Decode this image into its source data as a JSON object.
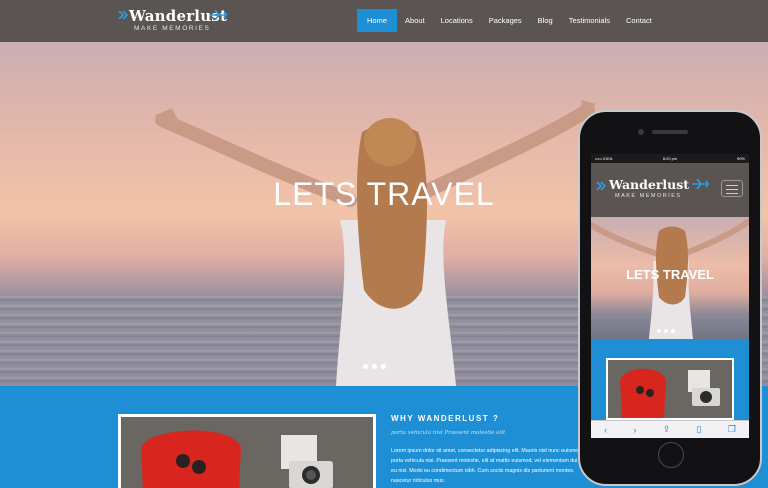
{
  "brand": {
    "name": "Wanderlust",
    "tagline": "MAKE MEMORIES",
    "accent_color": "#1e8fd5",
    "header_color": "#5a5553"
  },
  "nav": {
    "items": [
      {
        "label": "Home",
        "active": true
      },
      {
        "label": "About"
      },
      {
        "label": "Locations"
      },
      {
        "label": "Packages"
      },
      {
        "label": "Blog"
      },
      {
        "label": "Testimonials"
      },
      {
        "label": "Contact"
      }
    ]
  },
  "hero": {
    "title": "LETS TRAVEL",
    "slides": 3,
    "active_slide": 1
  },
  "about": {
    "title": "WHY WANDERLUST ?",
    "subtitle": "porta vehicula nisi Praesent molestie elit",
    "body": "Lorem ipsum dolor sit amet, consectetur adipiscing elit. Mauris nisl nunc euismod, porta vehicula nisi. Praesent molestie, elit at mattis euismod, vel elementum dui sem eu nisi. Morbi eu condimentum nibh. Cum sociis magnis dis parturient montes, nascetur ridiculus mus."
  },
  "phone": {
    "status": {
      "carrier": "••••• IDEA",
      "time": "8:20 pm",
      "battery": "90%"
    },
    "brand_name": "Wanderlust",
    "tagline": "MAKE MEMORIES",
    "hero_title": "LETS TRAVEL",
    "toolbar_icons": [
      "back-icon",
      "forward-icon",
      "share-icon",
      "bookmarks-icon",
      "tabs-icon"
    ]
  }
}
